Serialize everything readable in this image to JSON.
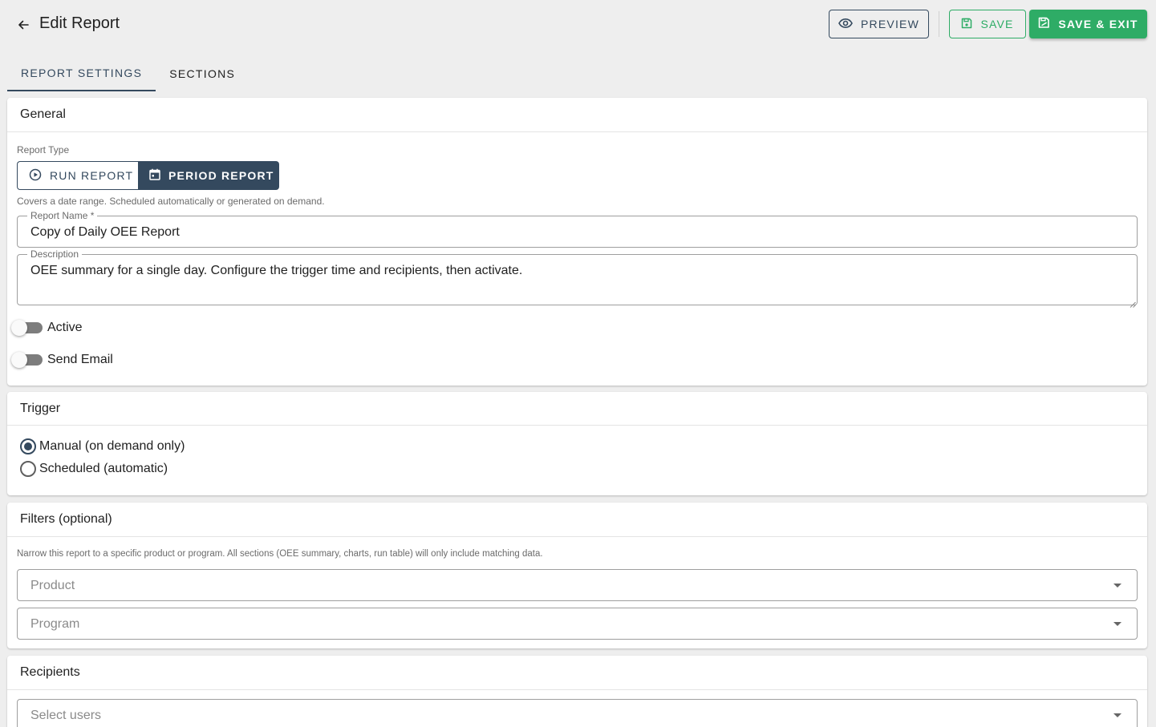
{
  "header": {
    "title": "Edit Report",
    "preview_label": "Preview",
    "save_label": "Save",
    "save_exit_label": "Save & Exit"
  },
  "tabs": [
    {
      "label": "Report Settings",
      "active": true
    },
    {
      "label": "Sections",
      "active": false
    }
  ],
  "general": {
    "title": "General",
    "report_type_caption": "Report Type",
    "run_report_label": "Run Report",
    "period_report_label": "Period Report",
    "selected_type": "Period Report",
    "type_hint": "Covers a date range. Scheduled automatically or generated on demand.",
    "report_name_label": "Report Name *",
    "report_name_value": "Copy of Daily OEE Report",
    "description_label": "Description",
    "description_value": "OEE summary for a single day. Configure the trigger time and recipients, then activate.",
    "active_label": "Active",
    "active_on": false,
    "send_email_label": "Send Email",
    "send_email_on": false
  },
  "trigger": {
    "title": "Trigger",
    "options": [
      {
        "label": "Manual (on demand only)",
        "checked": true
      },
      {
        "label": "Scheduled (automatic)",
        "checked": false
      }
    ]
  },
  "filters": {
    "title": "Filters (optional)",
    "hint": "Narrow this report to a specific product or program. All sections (OEE summary, charts, run table) will only include matching data.",
    "product_placeholder": "Product",
    "program_placeholder": "Program"
  },
  "recipients": {
    "title": "Recipients",
    "users_placeholder": "Select users"
  },
  "colors": {
    "primary": "#34495e",
    "success": "#2eac66",
    "background": "#eeeeee"
  }
}
